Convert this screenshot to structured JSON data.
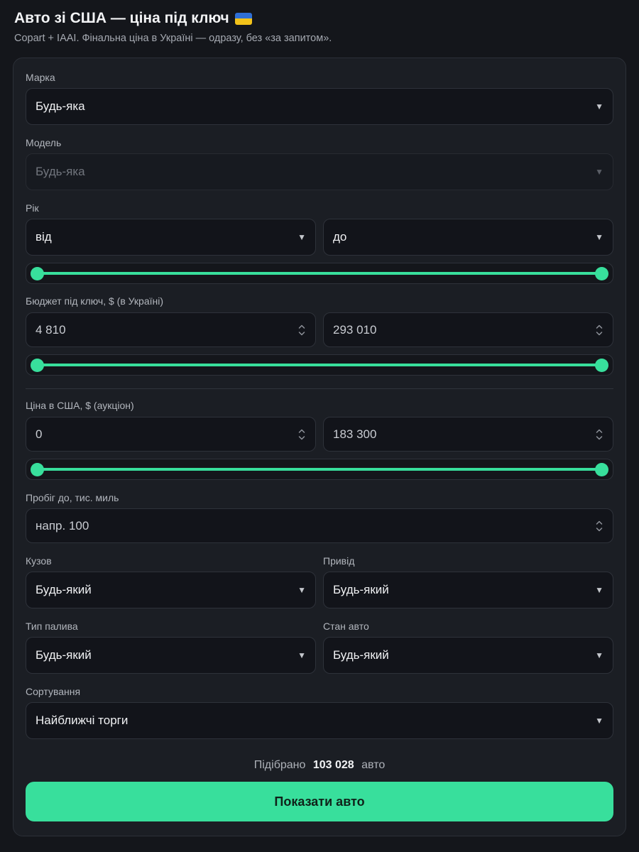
{
  "header": {
    "title": "Авто зі США — ціна під ключ",
    "subtitle": "Copart + IAAI. Фінальна ціна в Україні — одразу, без «за запитом»."
  },
  "form": {
    "make": {
      "label": "Марка",
      "value": "Будь-яка"
    },
    "model": {
      "label": "Модель",
      "value": "Будь-яка"
    },
    "year": {
      "label": "Рік",
      "from": "від",
      "to": "до",
      "range_fill": [
        0,
        1
      ]
    },
    "budget": {
      "label": "Бюджет під ключ, $ (в Україні)",
      "min": "4 810",
      "max": "293 010",
      "range_fill": [
        0,
        1
      ]
    },
    "us_price": {
      "label": "Ціна в США, $ (аукціон)",
      "min": "0",
      "max": "183 300",
      "range_fill": [
        0,
        1
      ]
    },
    "mileage": {
      "label": "Пробіг до, тис. миль",
      "placeholder": "напр. 100"
    },
    "body": {
      "label": "Кузов",
      "value": "Будь-який"
    },
    "drive": {
      "label": "Привід",
      "value": "Будь-який"
    },
    "fuel": {
      "label": "Тип палива",
      "value": "Будь-який"
    },
    "condition": {
      "label": "Стан авто",
      "value": "Будь-який"
    },
    "sort": {
      "label": "Сортування",
      "value": "Найближчі торги"
    }
  },
  "results": {
    "prefix": "Підібрано",
    "count": "103 028",
    "suffix": "авто"
  },
  "cta": {
    "label": "Показати авто"
  },
  "colors": {
    "accent": "#38df9c",
    "background": "#14161b",
    "card": "#1b1e24",
    "field": "#12141a"
  }
}
